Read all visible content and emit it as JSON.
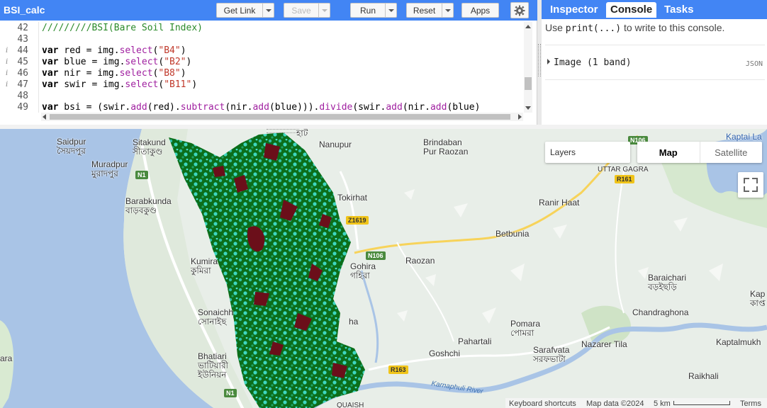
{
  "editor": {
    "script_title": "BSI_calc",
    "buttons": {
      "get_link": "Get Link",
      "save": "Save",
      "run": "Run",
      "reset": "Reset",
      "apps": "Apps"
    },
    "code_lines": [
      {
        "num": "42",
        "info": false,
        "text": "/////////BSI(Bare Soil Index)"
      },
      {
        "num": "43",
        "info": false,
        "text": ""
      },
      {
        "num": "44",
        "info": true,
        "text": "var red = img.select(\"B4\")"
      },
      {
        "num": "45",
        "info": true,
        "text": "var blue = img.select(\"B2\")"
      },
      {
        "num": "46",
        "info": true,
        "text": "var nir = img.select(\"B8\")"
      },
      {
        "num": "47",
        "info": true,
        "text": "var swir = img.select(\"B11\")"
      },
      {
        "num": "48",
        "info": false,
        "text": ""
      },
      {
        "num": "49",
        "info": false,
        "text": "var bsi = (swir.add(red).subtract(nir.add(blue))).divide(swir.add(nir.add(blue)"
      }
    ],
    "info_glyph": "i"
  },
  "console": {
    "tabs": [
      "Inspector",
      "Console",
      "Tasks"
    ],
    "active_tab": "Console",
    "hint_pre": "Use ",
    "hint_code": "print(...)",
    "hint_post": " to write to this console.",
    "output_item": "Image (1 band)",
    "json_label": "JSON"
  },
  "map": {
    "layers_label": "Layers",
    "map_type_options": [
      "Map",
      "Satellite"
    ],
    "map_type_selected": "Map",
    "places": [
      {
        "id": "saidpur",
        "lines": [
          "Saidpur",
          "সৈয়দপুর"
        ]
      },
      {
        "id": "sitakund",
        "lines": [
          "Sitakund",
          "সীতাকুণ্ড"
        ]
      },
      {
        "id": "muradpur",
        "lines": [
          "Muradpur",
          "মুরাদপুর"
        ]
      },
      {
        "id": "barabkunda",
        "lines": [
          "Barabkunda",
          "বাড়বকুণ্ড"
        ]
      },
      {
        "id": "kumira",
        "lines": [
          "Kumira",
          "কুমিরা"
        ]
      },
      {
        "id": "sonaichh",
        "lines": [
          "Sonaichh",
          "সোনাইছ"
        ]
      },
      {
        "id": "bhatiari",
        "lines": [
          "Bhatiari",
          "ভাটিয়ারী",
          "ইউনিয়ন"
        ]
      },
      {
        "id": "nanupur",
        "lines": [
          "Nanupur"
        ]
      },
      {
        "id": "brindaban",
        "lines": [
          "Brindaban",
          "Pur Raozan"
        ]
      },
      {
        "id": "tokirhat",
        "lines": [
          "Tokirhat"
        ]
      },
      {
        "id": "gohira",
        "lines": [
          "Gohira",
          "গহিরা"
        ]
      },
      {
        "id": "raozan",
        "lines": [
          "Raozan"
        ]
      },
      {
        "id": "betbunia",
        "lines": [
          "Betbunia"
        ]
      },
      {
        "id": "ranirhaat",
        "lines": [
          "Ranir Haat"
        ]
      },
      {
        "id": "uttargagra",
        "lines": [
          "UTTAR GAGRA"
        ]
      },
      {
        "id": "baraichari",
        "lines": [
          "Baraichari",
          "বড়ইছড়ি"
        ]
      },
      {
        "id": "chandraghona",
        "lines": [
          "Chandraghona"
        ]
      },
      {
        "id": "pomara",
        "lines": [
          "Pomara",
          "পোমরা"
        ]
      },
      {
        "id": "pahartali",
        "lines": [
          "Pahartali"
        ]
      },
      {
        "id": "goshchi",
        "lines": [
          "Goshchi"
        ]
      },
      {
        "id": "sarafvata",
        "lines": [
          "Sarafvata",
          "সরফভাটা"
        ]
      },
      {
        "id": "nazarertila",
        "lines": [
          "Nazarer Tila"
        ]
      },
      {
        "id": "kaptalmukh",
        "lines": [
          "Kaptalmukh"
        ]
      },
      {
        "id": "raikhali",
        "lines": [
          "Raikhali"
        ]
      },
      {
        "id": "kaptai",
        "lines": [
          "Kaptai La"
        ]
      },
      {
        "id": "kap",
        "lines": [
          "Kap",
          "কাপ্ত"
        ]
      },
      {
        "id": "quaish",
        "lines": [
          "QUAISH"
        ]
      },
      {
        "id": "ara",
        "lines": [
          "ara"
        ]
      },
      {
        "id": "ha",
        "lines": [
          "ha"
        ]
      },
      {
        "id": "hat",
        "lines": [
          "হাট"
        ]
      }
    ],
    "road_badges": [
      "N1",
      "N1",
      "Z1619",
      "N106",
      "R161",
      "N106",
      "R163"
    ],
    "river_label": "Karnaphuli River",
    "attribution": {
      "shortcuts": "Keyboard shortcuts",
      "data": "Map data ©2024",
      "scale": "5 km",
      "terms": "Terms"
    }
  },
  "colors": {
    "accent": "#4285f4",
    "veg_dark": "#0b6e1a",
    "veg_light": "#3fd6c0",
    "bare_soil": "#6b0f1a",
    "water": "#a9c4e6",
    "land": "#e8eee8"
  }
}
